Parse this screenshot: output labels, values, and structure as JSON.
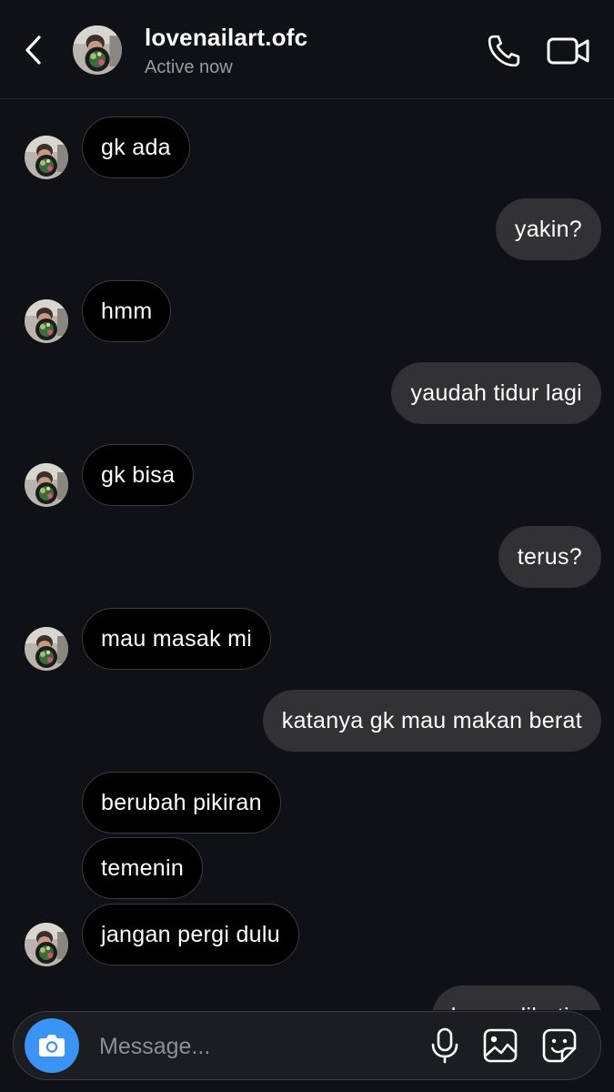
{
  "header": {
    "username": "lovenailart.ofc",
    "status": "Active now"
  },
  "composer": {
    "placeholder": "Message..."
  },
  "messages": [
    {
      "text": "gk ada"
    },
    {
      "text": "yakin?"
    },
    {
      "text": "hmm"
    },
    {
      "text": "yaudah tidur lagi"
    },
    {
      "text": "gk bisa"
    },
    {
      "text": "terus?"
    },
    {
      "text": "mau masak mi"
    },
    {
      "text": "katanya gk mau makan berat"
    },
    {
      "text": "berubah pikiran"
    },
    {
      "text": "temenin"
    },
    {
      "text": "jangan pergi dulu"
    },
    {
      "text": "kapan lihatin"
    }
  ],
  "icons": {
    "back": "chevron-left-icon",
    "call": "phone-icon",
    "video": "video-camera-icon",
    "camera": "camera-icon",
    "mic": "microphone-icon",
    "gallery": "image-icon",
    "sticker": "sticker-icon"
  },
  "colors": {
    "background": "#101117",
    "incoming_bubble": "#000000",
    "outgoing_bubble": "#313136",
    "camera_button": "#3a94f5"
  }
}
